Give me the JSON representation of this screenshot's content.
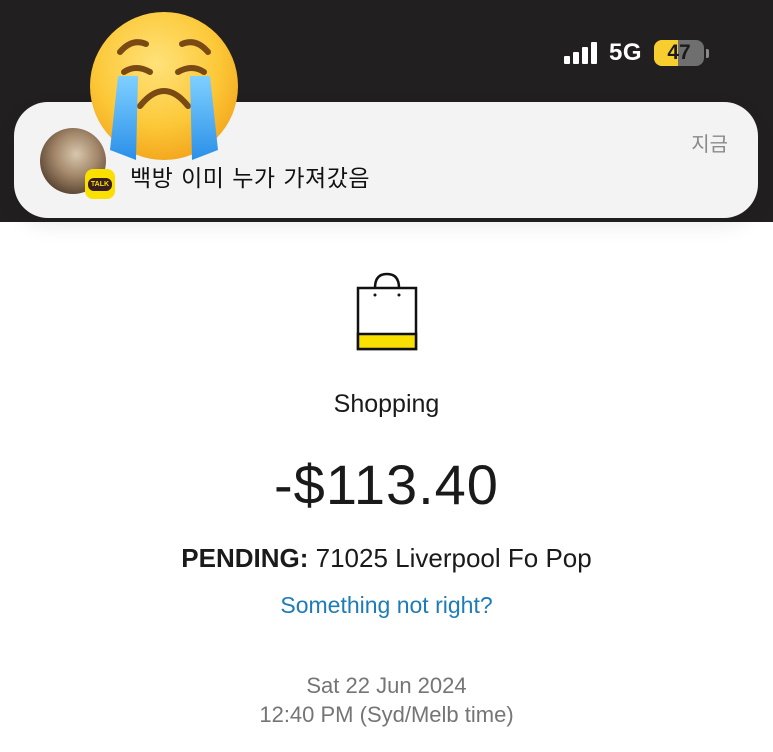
{
  "status_bar": {
    "network": "5G",
    "battery_level": "47",
    "battery_fraction": 0.47,
    "signal_bars": 4,
    "icons": [
      "signal-icon",
      "battery-icon"
    ]
  },
  "overlay": {
    "icon": "crying-face-emoji"
  },
  "notification": {
    "app_icon": "kakaotalk-icon",
    "badge_text": "TALK",
    "message": "백방 이미 누가 가져갔음",
    "time": "지금"
  },
  "transaction": {
    "icon": "shopping-bag-icon",
    "category": "Shopping",
    "amount": "-$113.40",
    "status_label": "PENDING:",
    "merchant": "71025 Liverpool Fo Pop",
    "help_link": "Something not right?",
    "date": "Sat 22 Jun 2024",
    "time": "12:40 PM (Syd/Melb time)"
  },
  "colors": {
    "status_bar_bg": "#221f20",
    "battery_fill": "#f7ce2e",
    "link": "#1d7bb8",
    "bag_accent": "#f9e000",
    "kakao_yellow": "#f9e000"
  }
}
